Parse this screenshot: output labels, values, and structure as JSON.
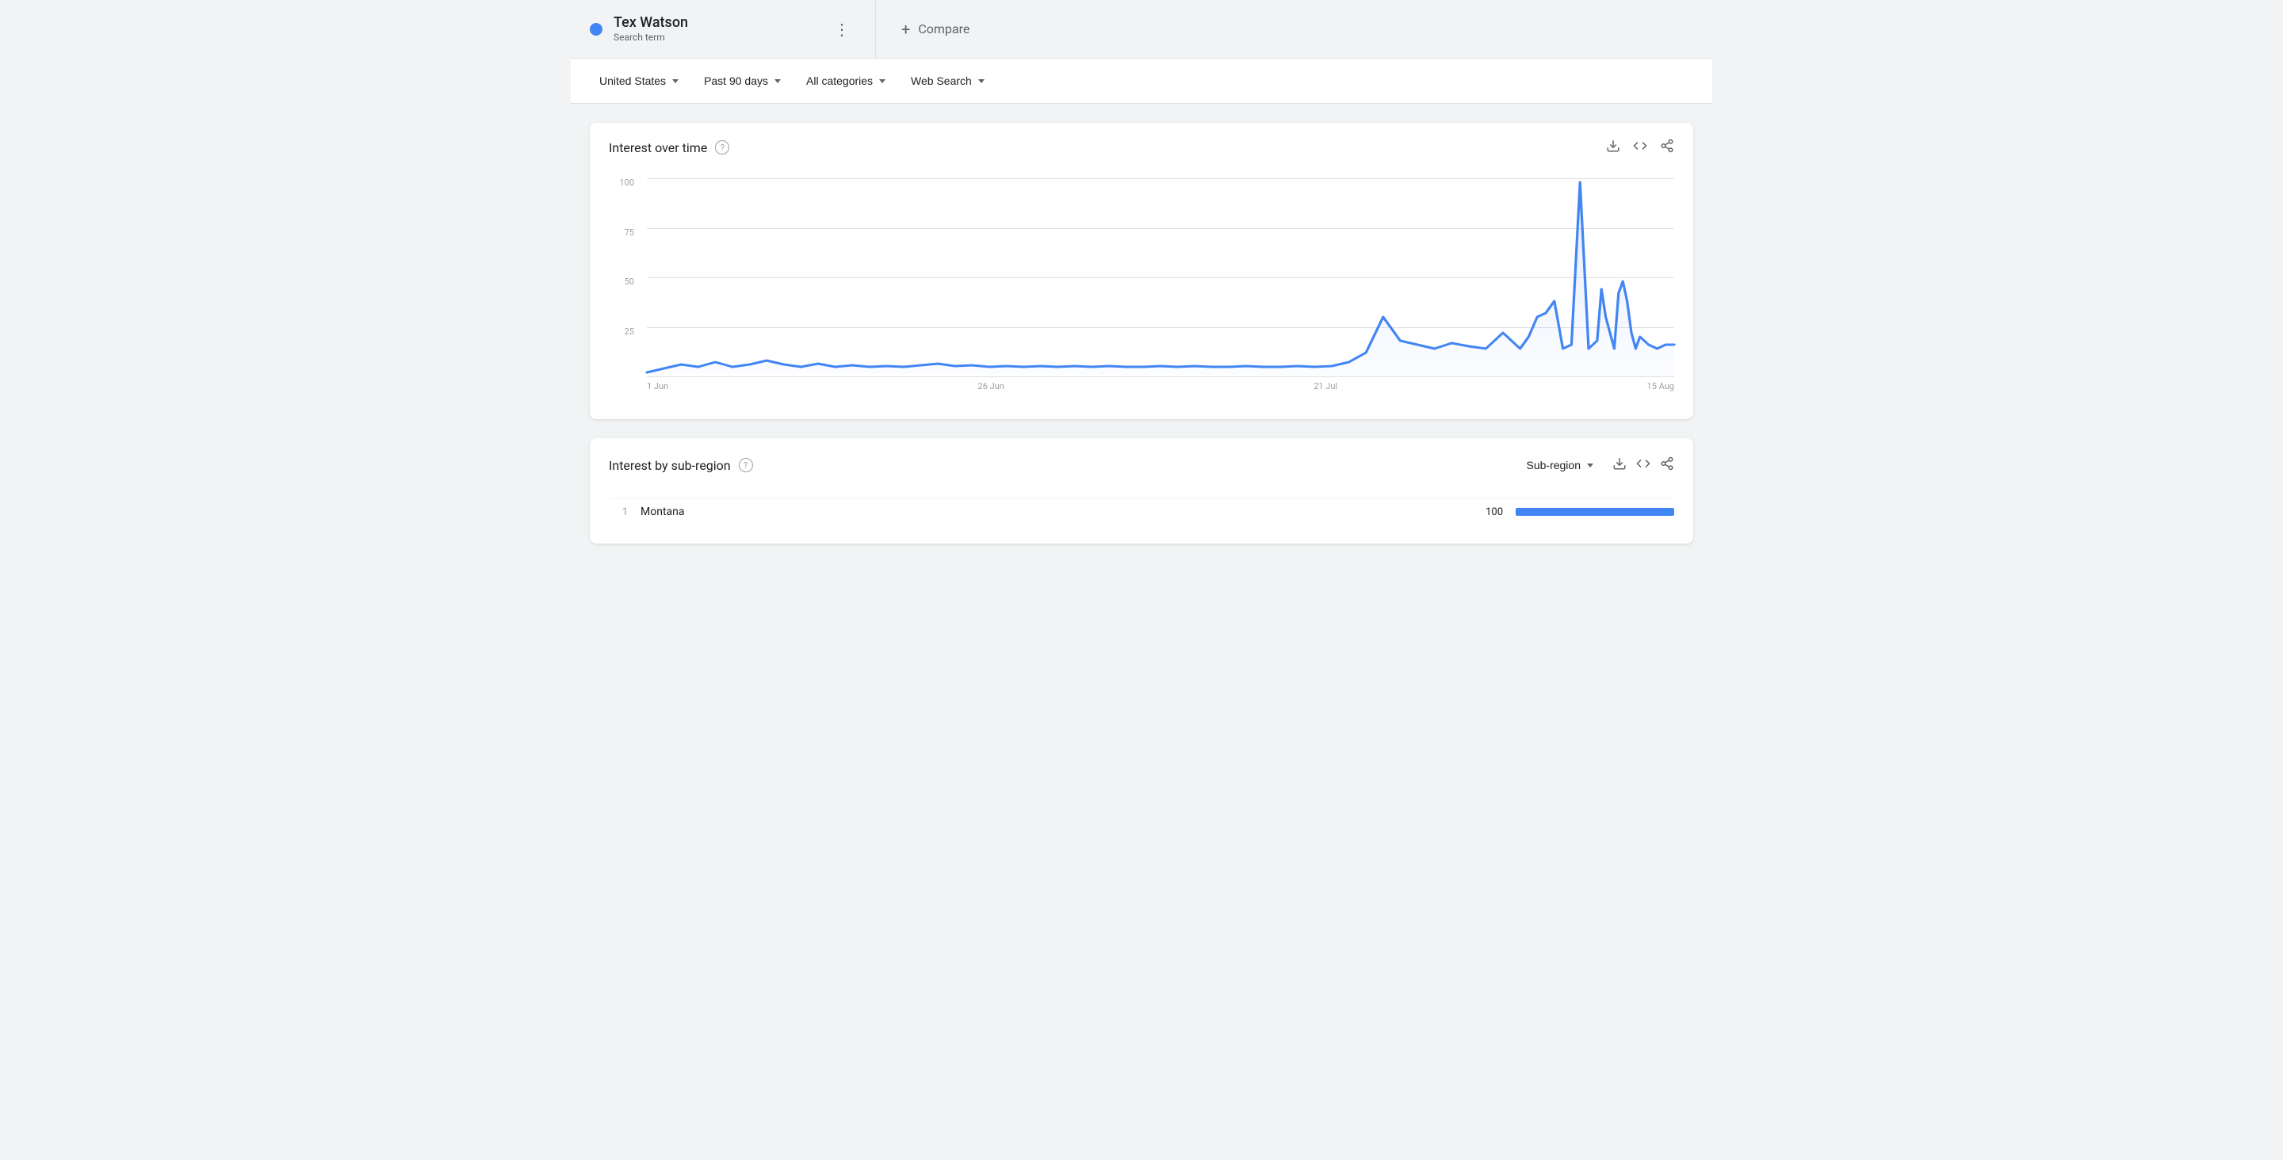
{
  "search_term": {
    "label": "Tex Watson",
    "sublabel": "Search term",
    "dot_color": "#4285f4"
  },
  "compare": {
    "label": "Compare",
    "plus_symbol": "+"
  },
  "filters": [
    {
      "id": "region",
      "label": "United States"
    },
    {
      "id": "time",
      "label": "Past 90 days"
    },
    {
      "id": "category",
      "label": "All categories"
    },
    {
      "id": "search_type",
      "label": "Web Search"
    }
  ],
  "interest_over_time": {
    "title": "Interest over time",
    "y_labels": [
      "100",
      "75",
      "50",
      "25",
      ""
    ],
    "x_labels": [
      "1 Jun",
      "26 Jun",
      "21 Jul",
      "15 Aug"
    ],
    "chart_color": "#4285f4"
  },
  "interest_by_subregion": {
    "title": "Interest by sub-region",
    "dropdown_label": "Sub-region",
    "rows": [
      {
        "rank": "1",
        "name": "Montana",
        "value": "100",
        "bar_pct": 100
      }
    ]
  },
  "icons": {
    "menu_dots": "⋮",
    "download": "↓",
    "embed": "<>",
    "share": "↗",
    "help": "?"
  }
}
